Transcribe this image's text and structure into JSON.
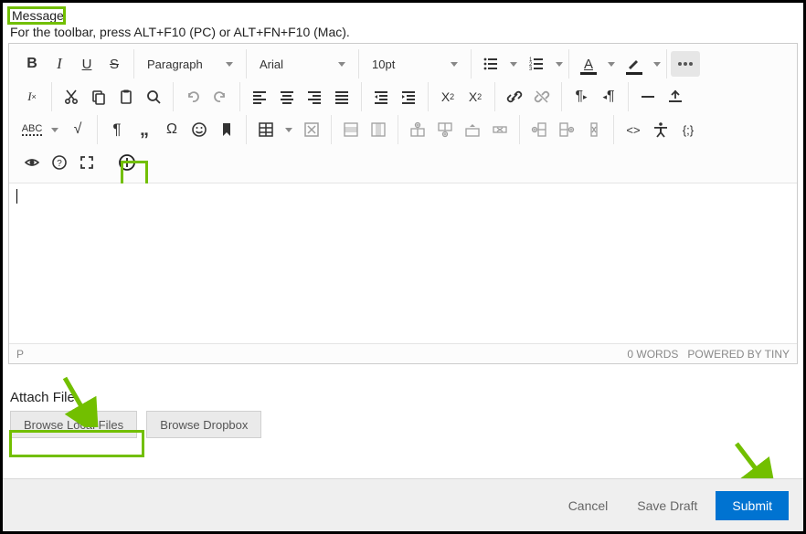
{
  "header": {
    "label": "Message",
    "hint": "For the toolbar, press ALT+F10 (PC) or ALT+FN+F10 (Mac)."
  },
  "toolbar": {
    "paragraph": "Paragraph",
    "font": "Arial",
    "size": "10pt"
  },
  "statusbar": {
    "path": "P",
    "words": "0 WORDS",
    "powered": "POWERED BY TINY"
  },
  "attach": {
    "label": "Attach File",
    "browse_local": "Browse Local Files",
    "browse_dropbox": "Browse Dropbox"
  },
  "footer": {
    "cancel": "Cancel",
    "save_draft": "Save Draft",
    "submit": "Submit"
  }
}
